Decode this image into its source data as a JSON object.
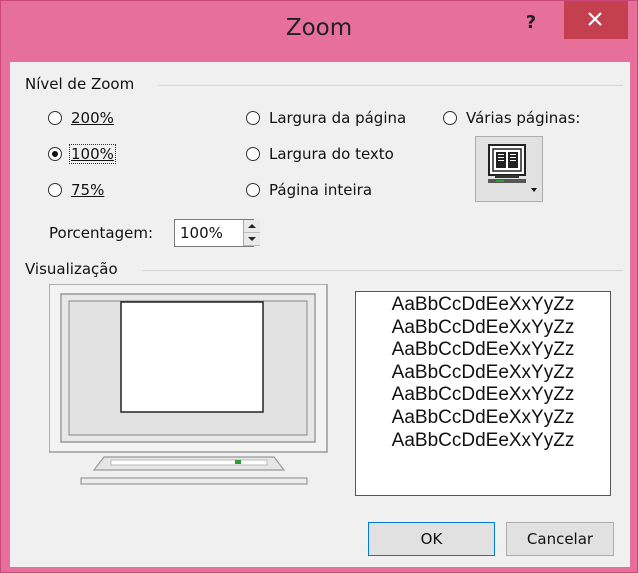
{
  "dialog": {
    "title": "Zoom",
    "help_label": "?"
  },
  "zoom_level": {
    "section_label": "Nível de Zoom",
    "options": [
      {
        "label": "200%",
        "checked": false
      },
      {
        "label": "100%",
        "checked": true
      },
      {
        "label": "75%",
        "checked": false
      },
      {
        "label": "Largura da página",
        "checked": false
      },
      {
        "label": "Largura do texto",
        "checked": false
      },
      {
        "label": "Página inteira",
        "checked": false
      },
      {
        "label": "Várias páginas:",
        "checked": false
      }
    ],
    "multi_pages_icon": "monitor-pages-icon"
  },
  "percentage": {
    "label": "Porcentagem:",
    "value": "100%"
  },
  "preview": {
    "section_label": "Visualização",
    "sample_text": "AaBbCcDdEeXxYyZz",
    "sample_lines": 7
  },
  "buttons": {
    "ok": "OK",
    "cancel": "Cancelar"
  },
  "colors": {
    "title_bar": "#e7709a",
    "close_button": "#c4404f",
    "default_button_border": "#0078d7"
  }
}
